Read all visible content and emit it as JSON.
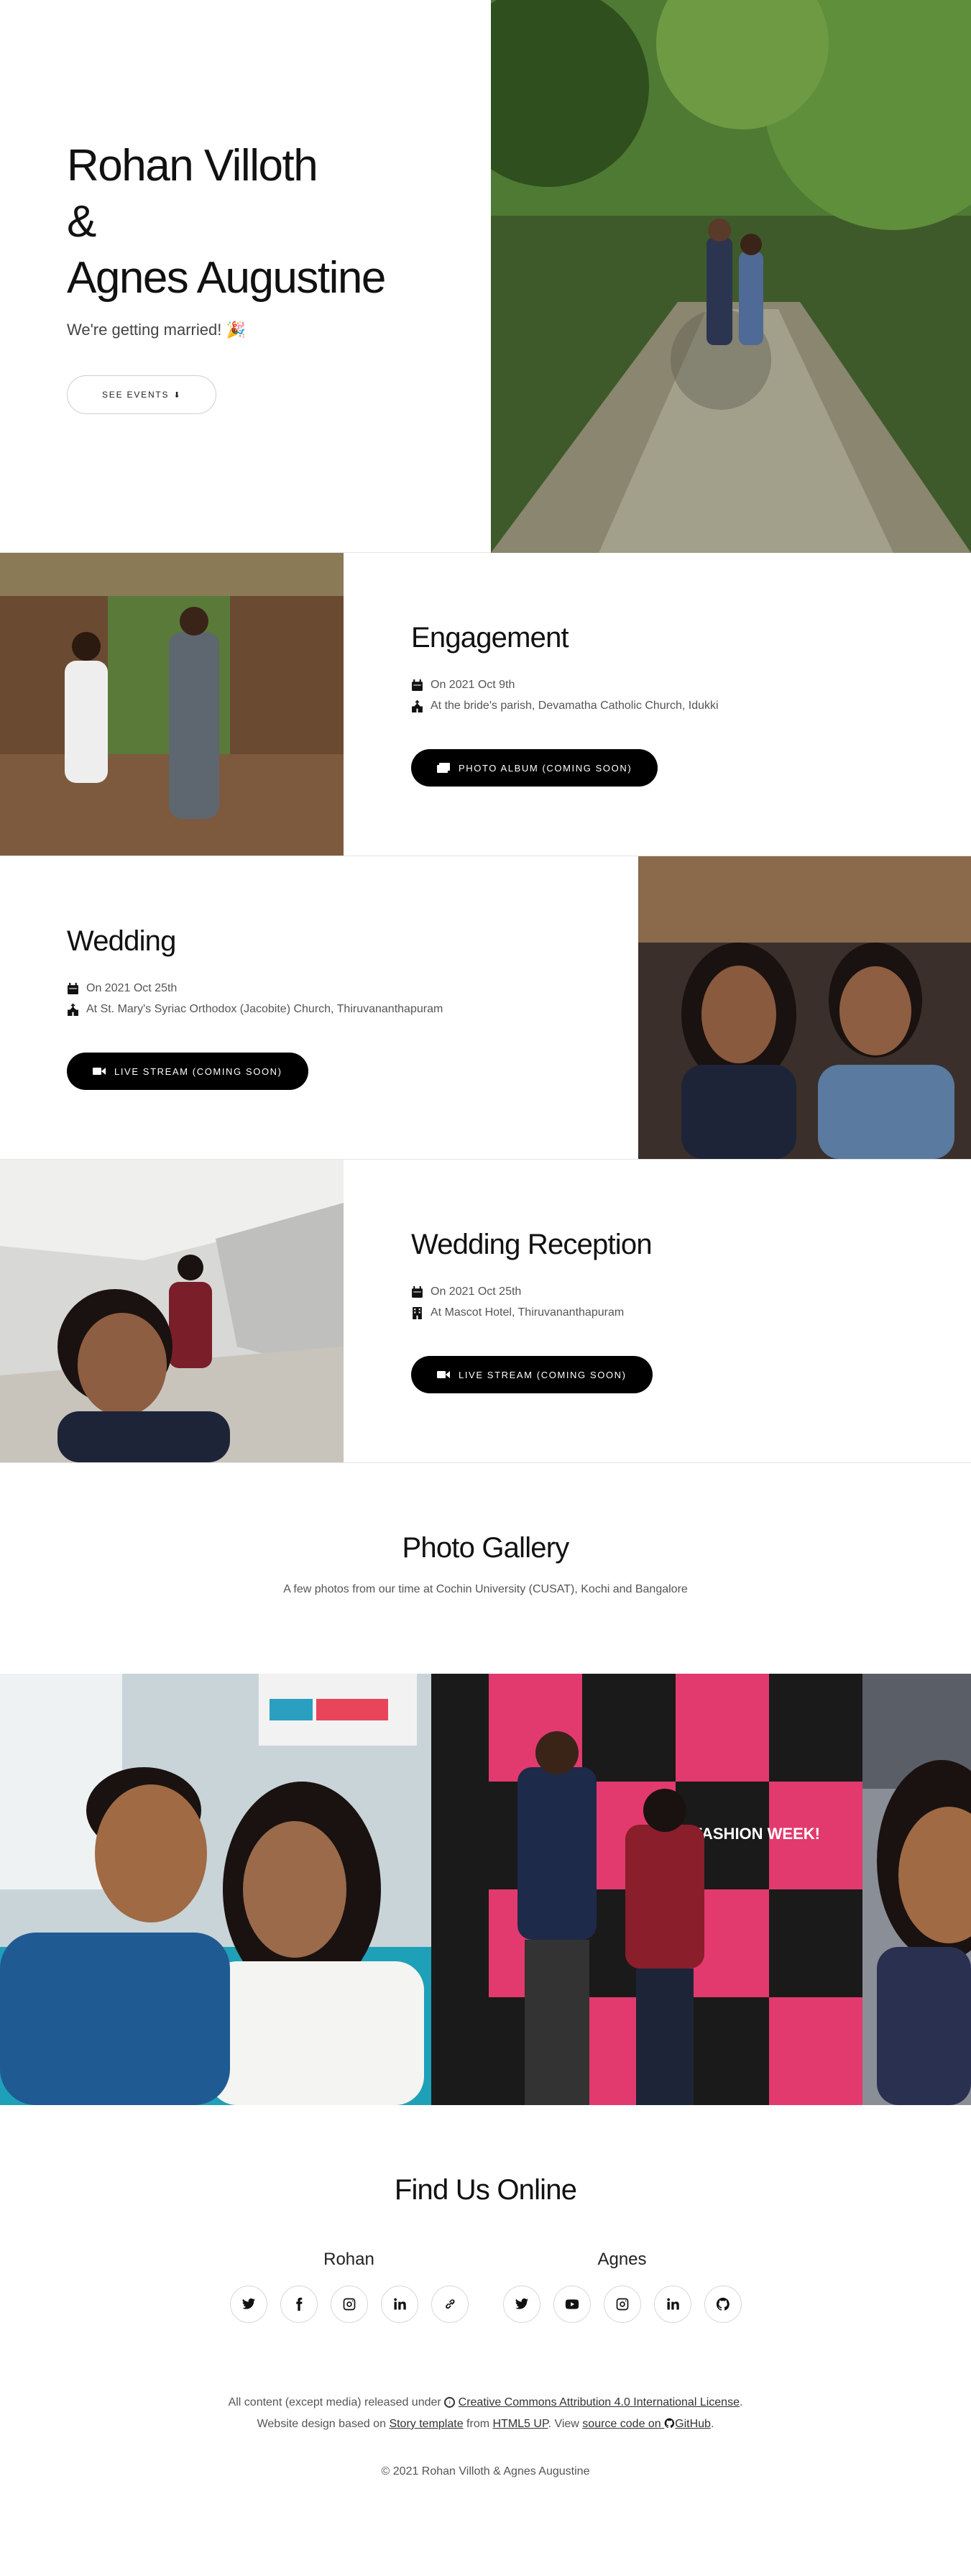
{
  "hero": {
    "name1": "Rohan Villoth",
    "amp": "&",
    "name2": "Agnes Augustine",
    "subtitle": "We're getting married! 🎉",
    "button": "SEE EVENTS"
  },
  "events": [
    {
      "title": "Engagement",
      "date": "On 2021 Oct 9th",
      "place": "At the bride's parish, Devamatha Catholic Church, Idukki",
      "button": "PHOTO ALBUM (COMING SOON)"
    },
    {
      "title": "Wedding",
      "date": "On 2021 Oct 25th",
      "place": "At St. Mary's Syriac Orthodox (Jacobite) Church, Thiruvananthapuram",
      "button": "LIVE STREAM (COMING SOON)"
    },
    {
      "title": "Wedding Reception",
      "date": "On 2021 Oct 25th",
      "place": "At Mascot Hotel, Thiruvananthapuram",
      "button": "LIVE STREAM (COMING SOON)"
    }
  ],
  "gallery": {
    "title": "Photo Gallery",
    "subtitle": "A few photos from our time at Cochin University (CUSAT), Kochi and Bangalore",
    "banner_text": "LULU FASHION WEEK!"
  },
  "online": {
    "title": "Find Us Online",
    "rohan": {
      "name": "Rohan",
      "icons": [
        "twitter-icon",
        "facebook-icon",
        "instagram-icon",
        "linkedin-icon",
        "link-icon"
      ]
    },
    "agnes": {
      "name": "Agnes",
      "icons": [
        "twitter-icon",
        "youtube-icon",
        "instagram-icon",
        "linkedin-icon",
        "github-icon"
      ]
    }
  },
  "footer": {
    "line1_pre": "All content (except media) released under",
    "license": "Creative Commons Attribution 4.0 International License",
    "line1_post": ".",
    "line2_pre": "Website design based on",
    "template": "Story template",
    "from": "from",
    "html5up": "HTML5 UP",
    "view": ". View",
    "source": "source code on",
    "github": "GitHub",
    "end": ".",
    "copyright": "© 2021 Rohan Villoth & Agnes Augustine"
  },
  "colors": {
    "accent": "#000000",
    "border": "#e5e5e5",
    "text": "#333333"
  }
}
